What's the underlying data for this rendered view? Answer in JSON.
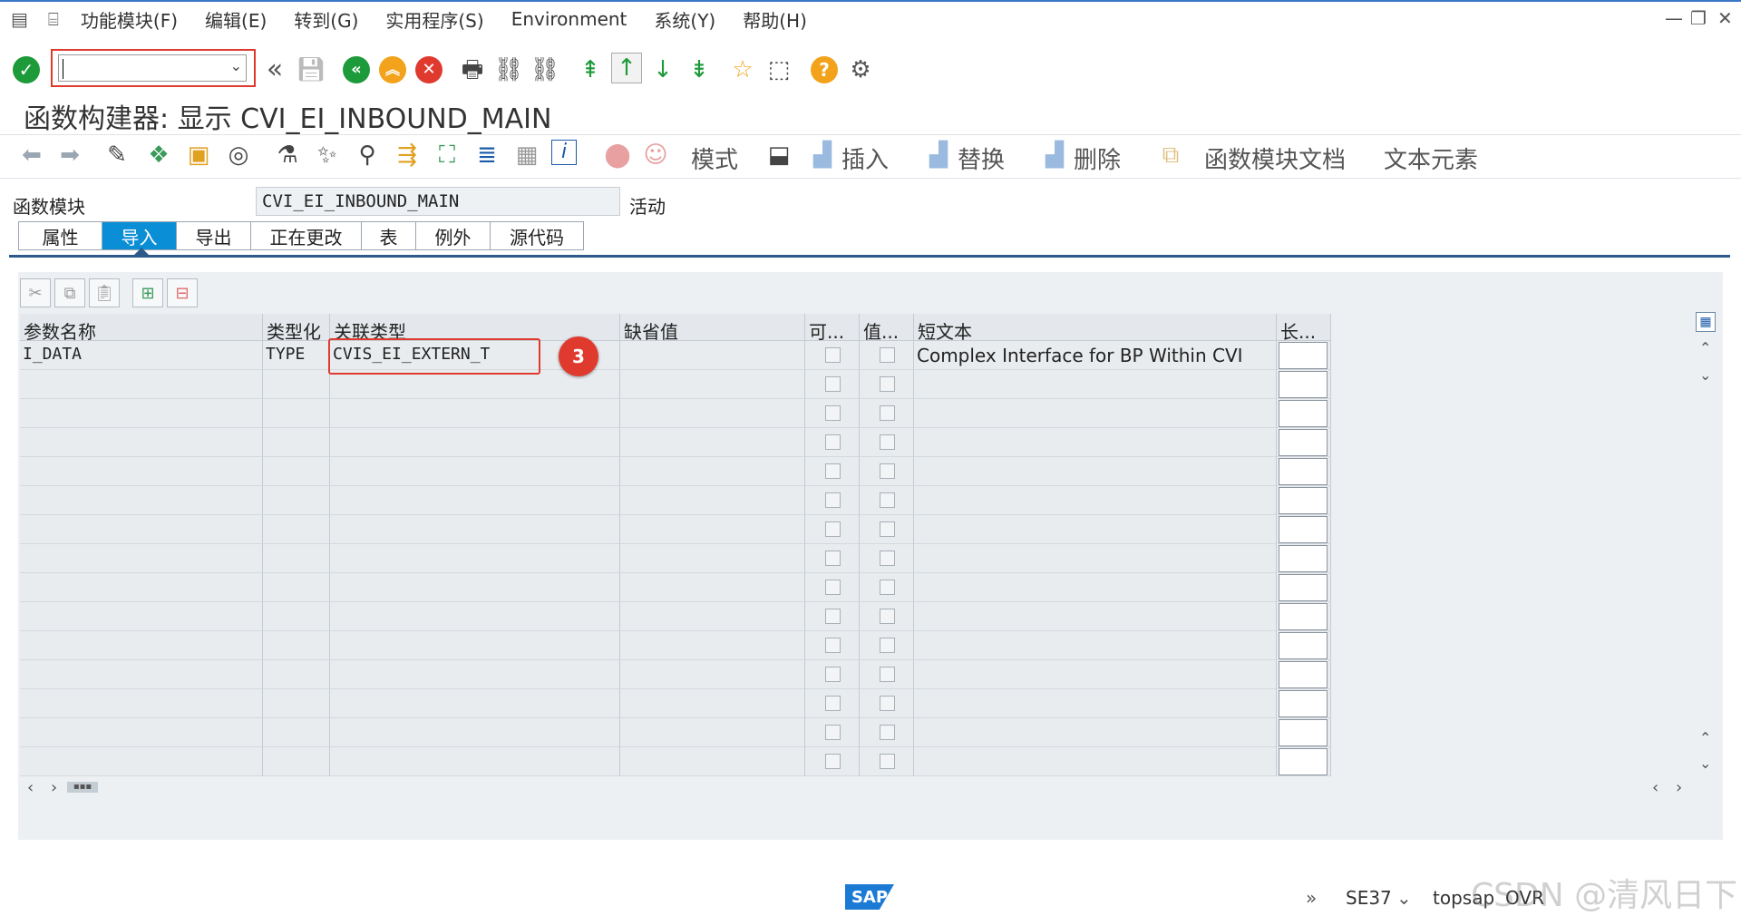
{
  "menu": {
    "items": [
      "功能模块(F)",
      "编辑(E)",
      "转到(G)",
      "实用程序(S)",
      "Environment",
      "系统(Y)",
      "帮助(H)"
    ]
  },
  "title": "函数构建器: 显示 CVI_EI_INBOUND_MAIN",
  "toolbar2": {
    "mode_label": "模式",
    "insert_label": "插入",
    "replace_label": "替换",
    "delete_label": "删除",
    "fm_doc_label": "函数模块文档",
    "text_elements_label": "文本元素"
  },
  "function_module": {
    "label": "函数模块",
    "value": "CVI_EI_INBOUND_MAIN",
    "status": "活动"
  },
  "tabs": [
    "属性",
    "导入",
    "导出",
    "正在更改",
    "表",
    "例外",
    "源代码"
  ],
  "active_tab": "导入",
  "table": {
    "headers": [
      "参数名称",
      "类型化",
      "关联类型",
      "缺省值",
      "可...",
      "值...",
      "短文本",
      "长..."
    ],
    "rows": [
      {
        "name": "I_DATA",
        "typing": "TYPE",
        "ref_type": "CVIS_EI_EXTERN_T",
        "default": "",
        "short_text": "Complex Interface for BP Within CVI"
      }
    ],
    "empty_rows": 14
  },
  "annotation": {
    "badge": "3"
  },
  "status": {
    "transaction": "SE37",
    "system": "topsap",
    "mode": "OVR",
    "watermark": "CSDN @清风日下",
    "logo": "SAP"
  },
  "colors": {
    "accent": "#0a8ed6",
    "highlight": "#e03a2f",
    "ok_green": "#1d9a3a",
    "back_green": "#1d9a3a",
    "exit_orange": "#f2a21b",
    "cancel_red": "#e03a2f",
    "help_yellow": "#f2a21b"
  }
}
